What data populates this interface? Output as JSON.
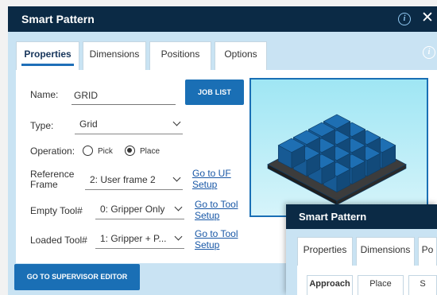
{
  "dialog": {
    "title": "Smart Pattern",
    "tabs": [
      {
        "label": "Properties",
        "active": true
      },
      {
        "label": "Dimensions",
        "active": false
      },
      {
        "label": "Positions",
        "active": false
      },
      {
        "label": "Options",
        "active": false
      }
    ],
    "form": {
      "name_label": "Name:",
      "name_value": "GRID",
      "job_list_button": "JOB LIST",
      "type_label": "Type:",
      "type_value": "Grid",
      "operation_label": "Operation:",
      "operation_options": [
        "Pick",
        "Place"
      ],
      "operation_selected": "Place",
      "reference_frame_label": "Reference Frame",
      "reference_frame_value": "2: User frame 2",
      "reference_frame_link": "Go to UF Setup",
      "empty_tool_label": "Empty Tool#",
      "empty_tool_value": "0: Gripper Only",
      "empty_tool_link": "Go to Tool Setup",
      "loaded_tool_label": "Loaded Tool#",
      "loaded_tool_value": "1: Gripper + P...",
      "loaded_tool_link": "Go to Tool Setup"
    },
    "footer_button": "GO TO SUPERVISOR EDITOR",
    "preview": {
      "rows": 4,
      "cols": 4,
      "box_color": "#1e6fb3",
      "tray_color": "#3c3c3c"
    }
  },
  "dialog2": {
    "title": "Smart Pattern",
    "tabs": [
      "Properties",
      "Dimensions",
      "Po"
    ],
    "subtabs": [
      "Approach",
      "Place",
      "S"
    ]
  },
  "colors": {
    "titlebar": "#0b2a45",
    "accent": "#1a6fb5",
    "frame": "#c9e3f3"
  }
}
